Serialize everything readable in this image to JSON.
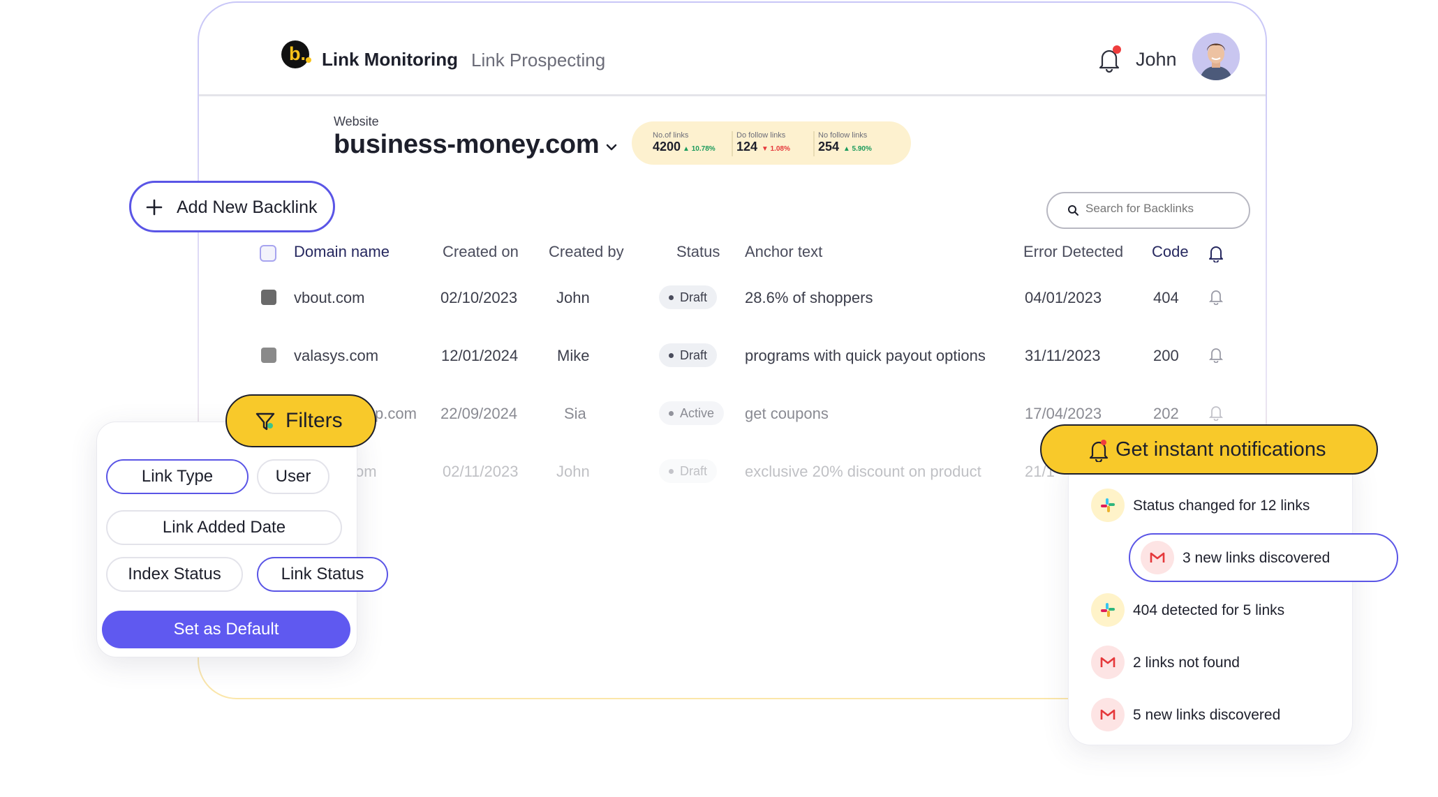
{
  "header": {
    "logo_letter": "b.",
    "nav_active": "Link Monitoring",
    "nav_item": "Link Prospecting",
    "user_name": "John"
  },
  "website": {
    "label": "Website",
    "value": "business-money.com"
  },
  "stats": [
    {
      "label": "No.of links",
      "value": "4200",
      "change": "10.78%",
      "direction": "up"
    },
    {
      "label": "Do follow links",
      "value": "124",
      "change": "1.08%",
      "direction": "down"
    },
    {
      "label": "No follow links",
      "value": "254",
      "change": "5.90%",
      "direction": "up"
    }
  ],
  "search": {
    "placeholder": "Search for Backlinks"
  },
  "add_button": {
    "label": "Add New Backlink"
  },
  "table": {
    "headers": {
      "domain": "Domain name",
      "created_on": "Created on",
      "created_by": "Created by",
      "status": "Status",
      "anchor": "Anchor text",
      "error": "Error Detected",
      "code": "Code"
    },
    "rows": [
      {
        "domain": "vbout.com",
        "created_on": "02/10/2023",
        "created_by": "John",
        "status": "Draft",
        "anchor": "28.6% of shoppers",
        "error": "04/01/2023",
        "code": "404"
      },
      {
        "domain": "valasys.com",
        "created_on": "12/01/2024",
        "created_by": "Mike",
        "status": "Draft",
        "anchor": "programs with quick payout options",
        "error": "31/11/2023",
        "code": "200"
      },
      {
        "domain": "p.com",
        "created_on": "22/09/2024",
        "created_by": "Sia",
        "status": "Active",
        "anchor": "get coupons",
        "error": "17/04/2023",
        "code": "202"
      },
      {
        "domain": "om",
        "created_on": "02/11/2023",
        "created_by": "John",
        "status": "Draft",
        "anchor": "exclusive 20% discount on product",
        "error": "21/1",
        "code": ""
      }
    ]
  },
  "filters": {
    "title": "Filters",
    "chips": {
      "link_type": "Link Type",
      "user": "User",
      "link_added_date": "Link Added Date",
      "index_status": "Index Status",
      "link_status": "Link Status"
    },
    "default_button": "Set as Default"
  },
  "notifications": {
    "title": "Get instant notifications",
    "items": [
      {
        "source": "slack",
        "text": "Status changed for 12 links"
      },
      {
        "source": "gmail",
        "text": "3 new links discovered"
      },
      {
        "source": "slack",
        "text": "404 detected for 5 links"
      },
      {
        "source": "gmail",
        "text": "2 links not found"
      },
      {
        "source": "gmail",
        "text": "5 new links discovered"
      }
    ]
  },
  "colors": {
    "accent": "#5f59f0",
    "highlight": "#f8c92a",
    "up": "#1a9a5b",
    "down": "#e5383b"
  }
}
